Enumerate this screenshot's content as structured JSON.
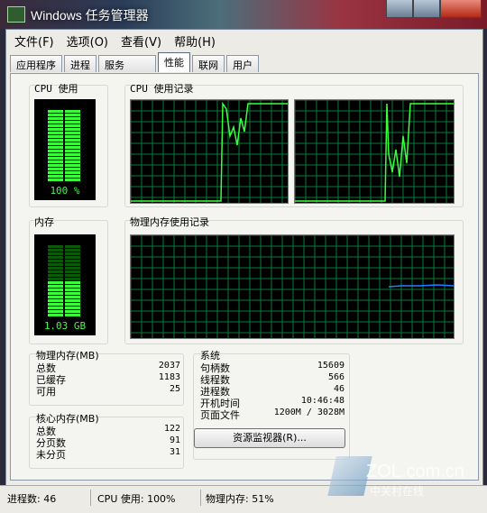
{
  "window": {
    "title": "Windows 任务管理器"
  },
  "menu": [
    "文件(F)",
    "选项(O)",
    "查看(V)",
    "帮助(H)"
  ],
  "tabs": [
    {
      "label": "应用程序",
      "active": false
    },
    {
      "label": "进程",
      "active": false
    },
    {
      "label": "服务",
      "active": false
    },
    {
      "label": "性能",
      "active": true
    },
    {
      "label": "联网",
      "active": false
    },
    {
      "label": "用户",
      "active": false
    }
  ],
  "cpu_usage": {
    "title": "CPU 使用",
    "value": "100 %",
    "level": 1.0
  },
  "cpu_history": {
    "title": "CPU 使用记录"
  },
  "memory": {
    "title": "内存",
    "value": "1.03 GB",
    "level": 0.51
  },
  "memory_history": {
    "title": "物理内存使用记录"
  },
  "physical_memory": {
    "title": "物理内存(MB)",
    "rows": [
      {
        "label": "总数",
        "value": "2037"
      },
      {
        "label": "已缓存",
        "value": "1183"
      },
      {
        "label": "可用",
        "value": "25"
      }
    ]
  },
  "kernel_memory": {
    "title": "核心内存(MB)",
    "rows": [
      {
        "label": "总数",
        "value": "122"
      },
      {
        "label": "分页数",
        "value": "91"
      },
      {
        "label": "未分页",
        "value": "31"
      }
    ]
  },
  "system": {
    "title": "系统",
    "rows": [
      {
        "label": "句柄数",
        "value": "15609"
      },
      {
        "label": "线程数",
        "value": "566"
      },
      {
        "label": "进程数",
        "value": "46"
      },
      {
        "label": "开机时间",
        "value": "10:46:48"
      },
      {
        "label": "页面文件",
        "value": "1200M / 3028M"
      }
    ]
  },
  "resource_monitor_button": "资源监视器(R)...",
  "statusbar": {
    "processes": "进程数: 46",
    "cpu": "CPU 使用: 100%",
    "memory": "物理内存: 51%"
  },
  "watermark": {
    "brand": "ZOL.com.cn",
    "sub": "中关村在线"
  },
  "colors": {
    "meter_green": "#3cff3c",
    "grid_green": "#0a7a3a",
    "cpu_line": "#3cff3c",
    "mem_line": "#2a7aff"
  }
}
